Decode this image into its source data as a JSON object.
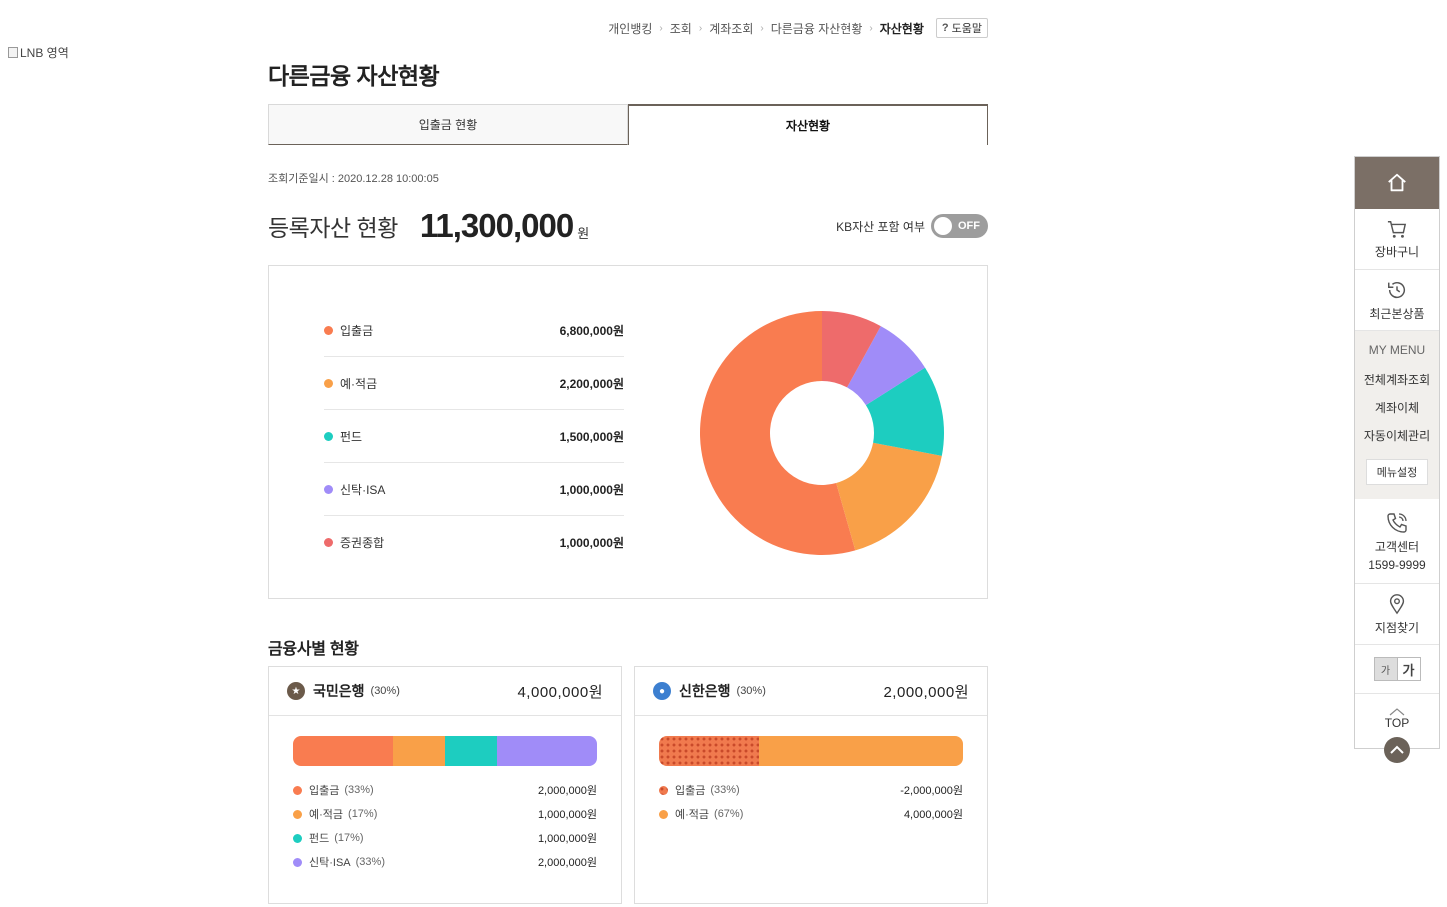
{
  "lnb_alt": "LNB 영역",
  "breadcrumb": {
    "items": [
      "개인뱅킹",
      "조회",
      "계좌조회",
      "다른금융 자산현황"
    ],
    "current": "자산현황",
    "help_icon": "?",
    "help_label": "도움말"
  },
  "page_title": "다른금융 자산현황",
  "tabs": [
    {
      "label": "입출금 현황"
    },
    {
      "label": "자산현황"
    }
  ],
  "query_time": "조회기준일시 : 2020.12.28 10:00:05",
  "total": {
    "label": "등록자산 현황",
    "amount": "11,300,000",
    "unit": "원"
  },
  "kb_toggle": {
    "label": "KB자산 포함 여부",
    "state": "OFF"
  },
  "summary": {
    "items": [
      {
        "name": "입출금",
        "value": "6,800,000원",
        "color": "#f97c50"
      },
      {
        "name": "예·적금",
        "value": "2,200,000원",
        "color": "#f9a048"
      },
      {
        "name": "펀드",
        "value": "1,500,000원",
        "color": "#1dcdc0"
      },
      {
        "name": "신탁·ISA",
        "value": "1,000,000원",
        "color": "#a08cf8"
      },
      {
        "name": "증권종합",
        "value": "1,000,000원",
        "color": "#ee6b6b"
      }
    ]
  },
  "chart_data": {
    "type": "pie",
    "title": "",
    "categories": [
      "입출금",
      "예·적금",
      "펀드",
      "신탁·ISA",
      "증권종합"
    ],
    "values": [
      6800000,
      2200000,
      1500000,
      1000000,
      1000000
    ],
    "colors": [
      "#f97c50",
      "#f9a048",
      "#1dcdc0",
      "#a08cf8",
      "#ee6b6b"
    ],
    "donut": true
  },
  "section_title": "금융사별 현황",
  "institutions": [
    {
      "name": "국민은행",
      "pct": "(30%)",
      "total": "4,000,000원",
      "logo_icon": "kb-bank-icon",
      "logo_color": "#6b5a4a",
      "bar": [
        {
          "share": 0.33,
          "color": "#f97c50"
        },
        {
          "share": 0.17,
          "color": "#f9a048"
        },
        {
          "share": 0.17,
          "color": "#1dcdc0"
        },
        {
          "share": 0.33,
          "color": "#a08cf8"
        }
      ],
      "items": [
        {
          "name": "입출금",
          "pct": "(33%)",
          "value": "2,000,000원",
          "color": "#f97c50"
        },
        {
          "name": "예·적금",
          "pct": "(17%)",
          "value": "1,000,000원",
          "color": "#f9a048"
        },
        {
          "name": "펀드",
          "pct": "(17%)",
          "value": "1,000,000원",
          "color": "#1dcdc0"
        },
        {
          "name": "신탁·ISA",
          "pct": "(33%)",
          "value": "2,000,000원",
          "color": "#a08cf8"
        }
      ]
    },
    {
      "name": "신한은행",
      "pct": "(30%)",
      "total": "2,000,000원",
      "logo_icon": "shinhan-bank-icon",
      "logo_color": "#3c7fd0",
      "bar": [
        {
          "share": 0.33,
          "color": "#f07a4e",
          "pattern": "dotted"
        },
        {
          "share": 0.67,
          "color": "#f9a048"
        }
      ],
      "items": [
        {
          "name": "입출금",
          "pct": "(33%)",
          "value": "-2,000,000원",
          "color": "#f07a4e",
          "pattern": "dotted"
        },
        {
          "name": "예·적금",
          "pct": "(67%)",
          "value": "4,000,000원",
          "color": "#f9a048"
        }
      ]
    }
  ],
  "quick_menu": {
    "home_icon": "home-icon",
    "cart": "장바구니",
    "recent": "최근본상품",
    "my_menu_title": "MY MENU",
    "my_menu_links": [
      "전체계좌조회",
      "계좌이체",
      "자동이체관리"
    ],
    "menu_settings": "메뉴설정",
    "call_label": "고객센터",
    "call_number": "1599-9999",
    "branch": "지점찾기",
    "font_small": "가",
    "font_large": "가",
    "top": "TOP"
  }
}
